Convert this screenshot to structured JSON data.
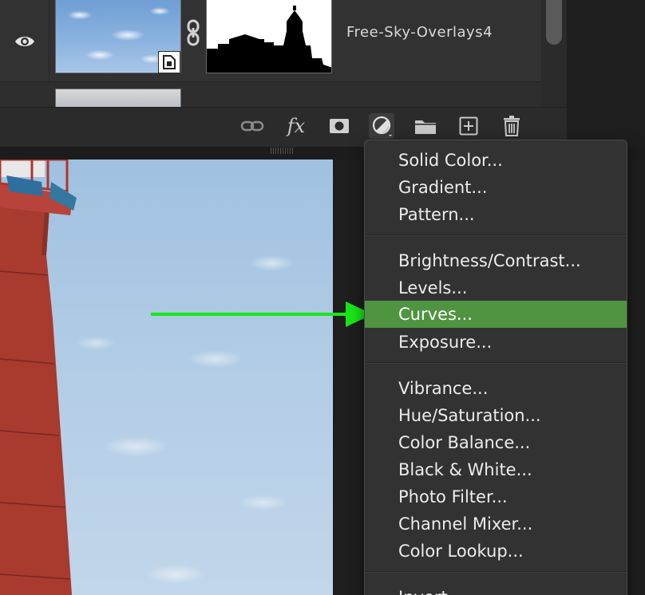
{
  "layers": {
    "layer_name": "Free-Sky-Overlays4"
  },
  "toolbar": {
    "fx_label": "fx",
    "icons": [
      "link-icon",
      "fx-icon",
      "mask-icon",
      "adjustment-icon",
      "folder-icon",
      "new-layer-icon",
      "trash-icon"
    ]
  },
  "menu": {
    "group1": [
      "Solid Color...",
      "Gradient...",
      "Pattern..."
    ],
    "group2": [
      "Brightness/Contrast...",
      "Levels...",
      "Curves...",
      "Exposure..."
    ],
    "group3": [
      "Vibrance...",
      "Hue/Saturation...",
      "Color Balance...",
      "Black & White...",
      "Photo Filter...",
      "Channel Mixer...",
      "Color Lookup..."
    ],
    "group4": [
      "Invert"
    ],
    "highlighted": "Curves..."
  },
  "colors": {
    "highlight": "#4f9440",
    "arrow": "#19e619",
    "panel": "#2b2b2b"
  }
}
